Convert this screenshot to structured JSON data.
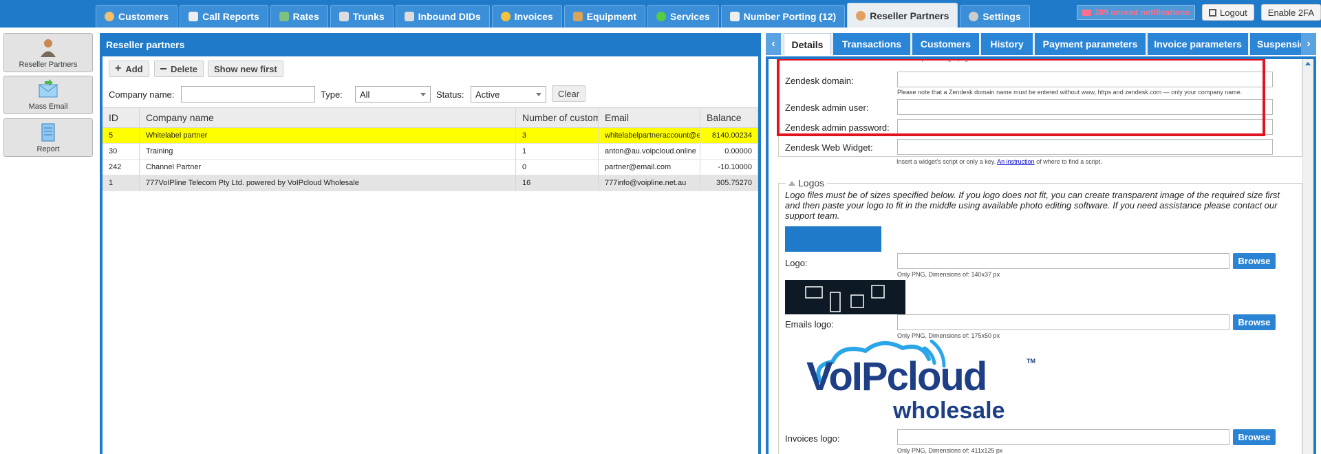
{
  "top_tabs": [
    {
      "label": "Customers",
      "icon": "user-icon",
      "color": "#f0c070"
    },
    {
      "label": "Call Reports",
      "icon": "report-icon",
      "color": "#eeeeee"
    },
    {
      "label": "Rates",
      "icon": "rates-icon",
      "color": "#7fbf7f"
    },
    {
      "label": "Trunks",
      "icon": "trunk-icon",
      "color": "#dddddd"
    },
    {
      "label": "Inbound DIDs",
      "icon": "list-icon",
      "color": "#dddddd"
    },
    {
      "label": "Invoices",
      "icon": "coins-icon",
      "color": "#f3c23a"
    },
    {
      "label": "Equipment",
      "icon": "box-icon",
      "color": "#d9a45a"
    },
    {
      "label": "Services",
      "icon": "refresh-icon",
      "color": "#55cc44"
    },
    {
      "label": "Number Porting (12)",
      "icon": "phone-icon",
      "color": "#eeeeee"
    },
    {
      "label": "Reseller Partners",
      "icon": "reseller-icon",
      "color": "#e0a060"
    },
    {
      "label": "Settings",
      "icon": "gear-icon",
      "color": "#cccccc"
    }
  ],
  "header": {
    "notifications": "209 unread notifications",
    "logout": "Logout",
    "enable_2fa": "Enable 2FA"
  },
  "left_nav": [
    {
      "label": "Reseller Partners"
    },
    {
      "label": "Mass Email"
    },
    {
      "label": "Report"
    }
  ],
  "left_panel": {
    "title": "Reseller partners",
    "add": "Add",
    "delete": "Delete",
    "show_new_first": "Show new first",
    "filters": {
      "company_label": "Company name:",
      "type_label": "Type:",
      "type_value": "All",
      "status_label": "Status:",
      "status_value": "Active",
      "clear": "Clear"
    },
    "columns": [
      "ID",
      "Company name",
      "Number of customers",
      "Email",
      "Balance"
    ],
    "rows": [
      [
        "5",
        "Whitelabel partner",
        "3",
        "whitelabelpartneraccount@email.com",
        "8140.00234"
      ],
      [
        "30",
        "Training",
        "1",
        "anton@au.voipcloud.online",
        "0.00000"
      ],
      [
        "242",
        "Channel Partner",
        "0",
        "partner@email.com",
        "-10.10000"
      ],
      [
        "1",
        "777VoIPline Telecom Pty Ltd. powered by VoIPcloud Wholesale",
        "16",
        "777info@voipline.net.au",
        "305.75270"
      ]
    ]
  },
  "right_tabs": [
    "Details",
    "Transactions",
    "Customers",
    "History",
    "Payment parameters",
    "Invoice parameters",
    "Suspension and"
  ],
  "details": {
    "top_hint": "Reseller partner login page URL. Default: Off",
    "zendesk_domain": "Zendesk domain:",
    "zendesk_domain_hint": "Please note that a Zendesk domain name must be entered without www, https and zendesk.com — only your company name.",
    "zendesk_admin_user": "Zendesk admin user:",
    "zendesk_admin_password": "Zendesk admin password:",
    "zendesk_web_widget": "Zendesk Web Widget:",
    "widget_hint_pre": "Insert a widget's script or only a key.",
    "widget_hint_link": "An instruction",
    "widget_hint_post": "of where to find a script.",
    "logos_legend": "Logos",
    "logos_text": "Logo files must be of sizes specified below. If you logo does not fit, you can create transparent image of the required size first and then paste your logo to fit in the middle using available photo editing software. If you need assistance please contact our support team.",
    "logo_label": "Logo:",
    "logo_hint": "Only PNG, Dimensions of: 140x37 px",
    "emails_logo_label": "Emails logo:",
    "emails_logo_hint": "Only PNG, Dimensions of: 175x50 px",
    "invoices_logo_label": "Invoices logo:",
    "invoices_logo_hint": "Only PNG, Dimensions of: 411x125 px",
    "browse": "Browse",
    "brand_main": "VoIPcloud",
    "brand_sub": "wholesale",
    "brand_tm": "TM"
  }
}
